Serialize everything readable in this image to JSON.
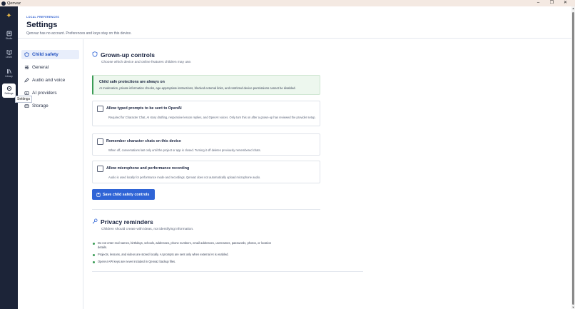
{
  "window": {
    "title": "Qenvaz",
    "minimize": "–",
    "maximize": "❐",
    "close": "✕"
  },
  "rail": {
    "items": [
      {
        "label": "Studio"
      },
      {
        "label": "Learn"
      },
      {
        "label": "Library"
      },
      {
        "label": "Settings"
      }
    ],
    "tooltip": "Settings"
  },
  "header": {
    "eyebrow": "LOCAL PREFERENCES",
    "title": "Settings",
    "subtitle": "Qenvaz has no account. Preferences and keys stay on this device."
  },
  "nav": {
    "items": [
      {
        "label": "Child safety",
        "icon": "shield-icon"
      },
      {
        "label": "General",
        "icon": "sliders-icon"
      },
      {
        "label": "Audio and voice",
        "icon": "microphone-icon"
      },
      {
        "label": "AI providers",
        "icon": "provider-icon"
      },
      {
        "label": "Storage",
        "icon": "storage-icon"
      }
    ]
  },
  "grownup": {
    "title": "Grown-up controls",
    "subtitle": "Choose which device and online features children may use.",
    "notice_title": "Child safe protections are always on",
    "notice_body": "AI moderation, private information checks, age-appropriate instructions, blocked external links, and restricted device permissions cannot be disabled.",
    "options": [
      {
        "title": "Allow typed prompts to be sent to OpenAI",
        "body": "Required for Character Chat, AI story drafting, responsive lesson replies, and OpenAI voices. Only turn this on after a grown-up has reviewed the provider setup.",
        "checked": false
      },
      {
        "title": "Remember character chats on this device",
        "body": "When off, conversations last only until the project or app is closed. Turning it off deletes previously remembered chats.",
        "checked": false
      },
      {
        "title": "Allow microphone and performance recording",
        "body": "Audio is used locally for performance mode and recordings. Qenvaz does not automatically upload microphone audio.",
        "checked": false
      }
    ],
    "save_label": "Save child safety controls"
  },
  "privacy": {
    "title": "Privacy reminders",
    "subtitle": "Children should create with ideas, not identifying information.",
    "bullets": [
      "Do not enter real names, birthdays, schools, addresses, phone numbers, email addresses, usernames, passwords, photos, or location details.",
      "Projects, lessons, and videos are stored locally. AI prompts are sent only when external AI is enabled.",
      "OpenAI API keys are never included in Qenvaz backup files."
    ]
  },
  "colors": {
    "accent": "#2f64d6",
    "rail": "#1c2438",
    "success": "#3a9b55"
  }
}
